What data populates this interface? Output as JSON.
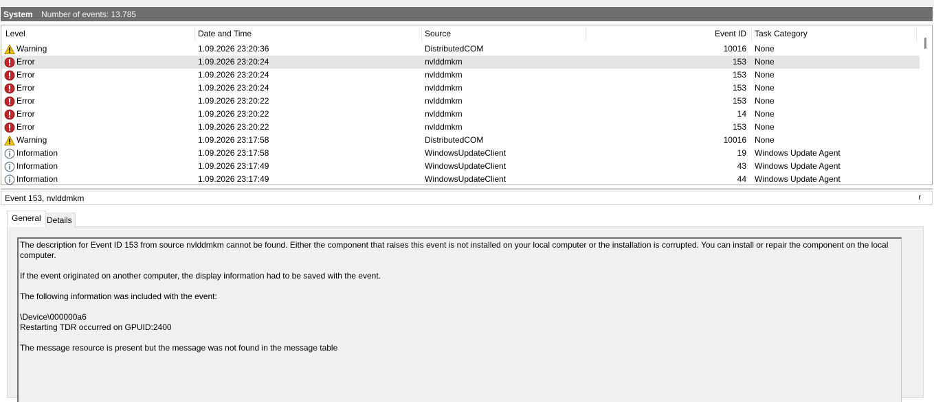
{
  "header": {
    "log_name": "System",
    "event_count": "Number of events: 13.785"
  },
  "columns": {
    "level": "Level",
    "date": "Date and Time",
    "source": "Source",
    "event_id": "Event ID",
    "category": "Task Category"
  },
  "rows": [
    {
      "level": "Warning",
      "icon": "warning-icon",
      "date": "1.09.2026 23:20:36",
      "source": "DistributedCOM",
      "event_id": "10016",
      "category": "None"
    },
    {
      "level": "Error",
      "icon": "error-icon",
      "date": "1.09.2026 23:20:24",
      "source": "nvlddmkm",
      "event_id": "153",
      "category": "None"
    },
    {
      "level": "Error",
      "icon": "error-icon",
      "date": "1.09.2026 23:20:24",
      "source": "nvlddmkm",
      "event_id": "153",
      "category": "None"
    },
    {
      "level": "Error",
      "icon": "error-icon",
      "date": "1.09.2026 23:20:24",
      "source": "nvlddmkm",
      "event_id": "153",
      "category": "None"
    },
    {
      "level": "Error",
      "icon": "error-icon",
      "date": "1.09.2026 23:20:22",
      "source": "nvlddmkm",
      "event_id": "153",
      "category": "None"
    },
    {
      "level": "Error",
      "icon": "error-icon",
      "date": "1.09.2026 23:20:22",
      "source": "nvlddmkm",
      "event_id": "14",
      "category": "None"
    },
    {
      "level": "Error",
      "icon": "error-icon",
      "date": "1.09.2026 23:20:22",
      "source": "nvlddmkm",
      "event_id": "153",
      "category": "None"
    },
    {
      "level": "Warning",
      "icon": "warning-icon",
      "date": "1.09.2026 23:17:58",
      "source": "DistributedCOM",
      "event_id": "10016",
      "category": "None"
    },
    {
      "level": "Information",
      "icon": "information-icon",
      "date": "1.09.2026 23:17:58",
      "source": "WindowsUpdateClient",
      "event_id": "19",
      "category": "Windows Update Agent"
    },
    {
      "level": "Information",
      "icon": "information-icon",
      "date": "1.09.2026 23:17:49",
      "source": "WindowsUpdateClient",
      "event_id": "43",
      "category": "Windows Update Agent"
    },
    {
      "level": "Information",
      "icon": "information-icon",
      "date": "1.09.2026 23:17:49",
      "source": "WindowsUpdateClient",
      "event_id": "44",
      "category": "Windows Update Agent"
    }
  ],
  "selected_row": 1,
  "detail": {
    "title": "Event 153, nvlddmkm",
    "close_glyph": "r",
    "tabs": {
      "general": "General",
      "details": "Details"
    },
    "paragraphs": [
      "The description for Event ID 153 from source nvlddmkm cannot be found. Either the component that raises this event is not installed on your local computer or the installation is corrupted. You can install or repair the component on the local computer.",
      "If the event originated on another computer, the display information had to be saved with the event.",
      "The following information was included with the event:",
      "\\Device\\000000a6\nRestarting TDR occurred on GPUID:2400",
      "The message resource is present but the message was not found in the message table"
    ]
  },
  "colors": {
    "titlebar": "#6f6f6f",
    "selection": "#e5e5e5",
    "error": "#c0272d",
    "warning": "#f5c400",
    "info": "#5a6e8a"
  }
}
